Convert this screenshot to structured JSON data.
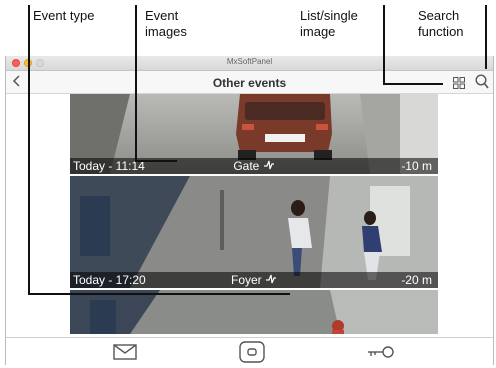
{
  "annotations": {
    "event_type": "Event type",
    "event_images": "Event\nimages",
    "list_single": "List/single\nimage",
    "search": "Search\nfunction"
  },
  "window": {
    "app_title": "MxSoftPanel",
    "screen_title": "Other events"
  },
  "toolbar": {
    "back_icon": "chevron-left-icon",
    "view_toggle_icon": "grid-icon",
    "search_icon": "search-icon"
  },
  "events": [
    {
      "time": "Today - 11:14",
      "type": "Gate",
      "distance": "-10 m"
    },
    {
      "time": "Today - 17:20",
      "type": "Foyer",
      "distance": "-20 m"
    }
  ],
  "tabbar": {
    "icons": [
      "envelope-icon",
      "doorbell-button-icon",
      "key-icon"
    ]
  }
}
